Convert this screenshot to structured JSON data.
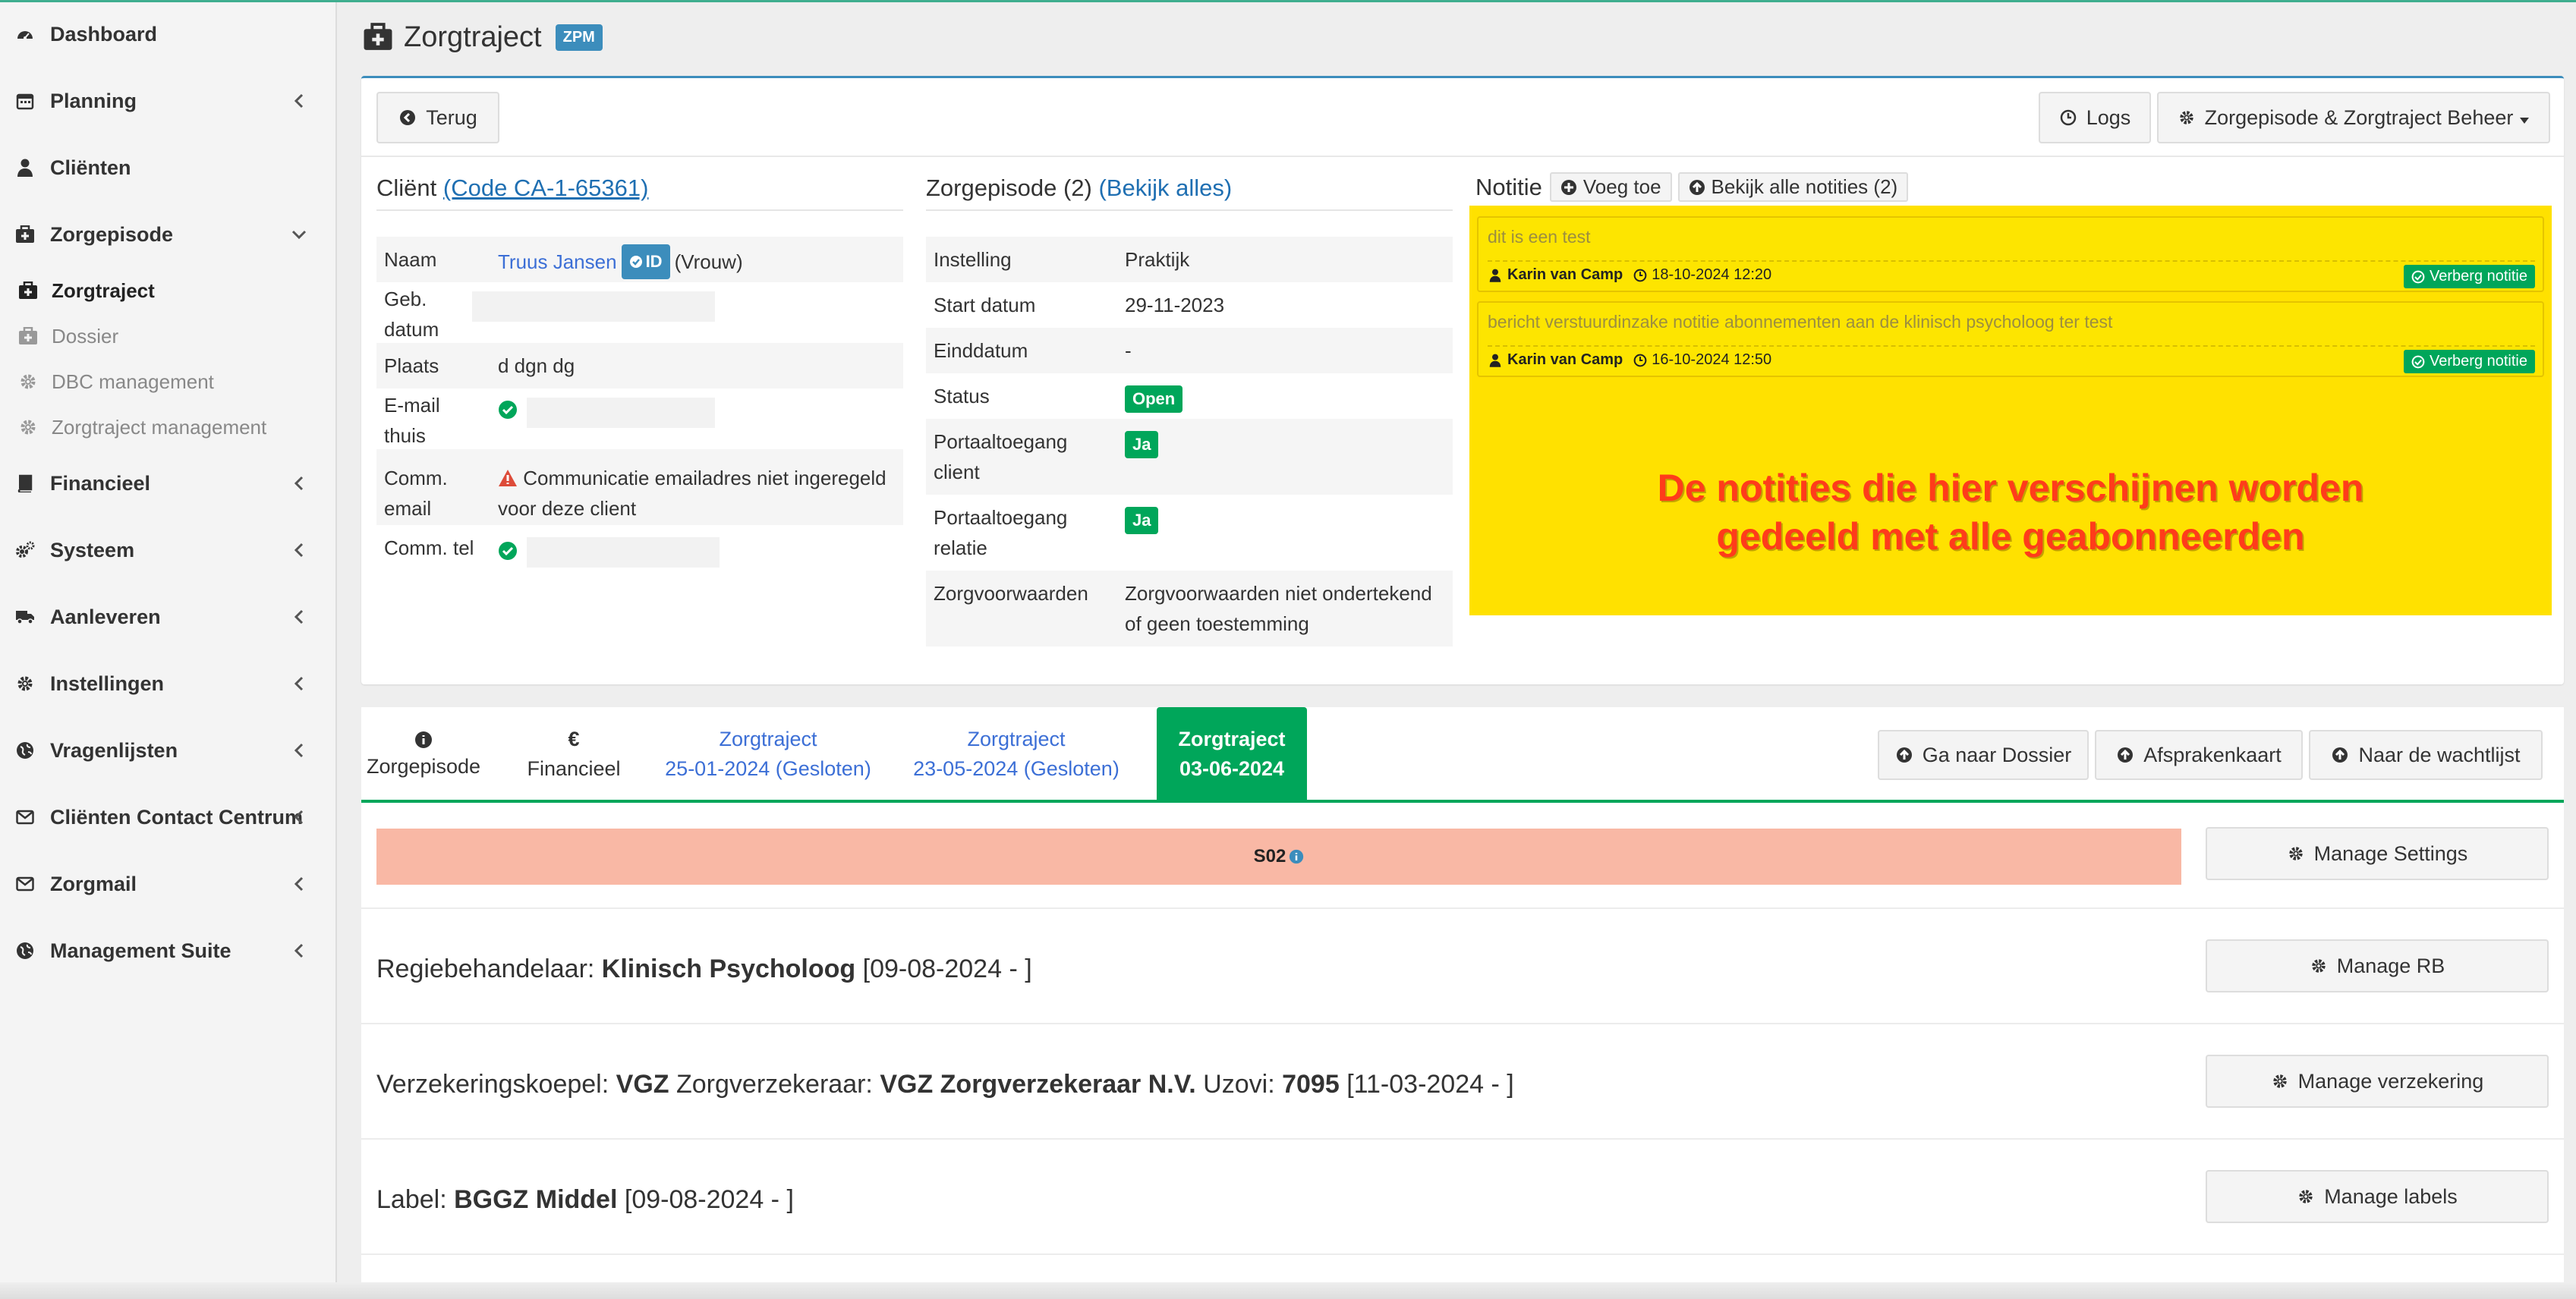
{
  "sidebar": {
    "items": [
      {
        "label": "Dashboard",
        "icon": "dashboard-icon"
      },
      {
        "label": "Planning",
        "icon": "calendar-icon"
      },
      {
        "label": "Cliënten",
        "icon": "user-icon"
      },
      {
        "label": "Zorgepisode",
        "icon": "medkit-icon"
      },
      {
        "label": "Financieel",
        "icon": "book-icon"
      },
      {
        "label": "Systeem",
        "icon": "cogs-icon"
      },
      {
        "label": "Aanleveren",
        "icon": "truck-icon"
      },
      {
        "label": "Instellingen",
        "icon": "gear-icon"
      },
      {
        "label": "Vragenlijsten",
        "icon": "globe-icon"
      },
      {
        "label": "Cliënten Contact Centrum",
        "icon": "envelope-icon"
      },
      {
        "label": "Zorgmail",
        "icon": "envelope-icon"
      },
      {
        "label": "Management Suite",
        "icon": "globe-icon"
      }
    ],
    "sub_items": [
      {
        "label": "Zorgtraject",
        "icon": "medkit-icon"
      },
      {
        "label": "Dossier",
        "icon": "medkit-icon"
      },
      {
        "label": "DBC management",
        "icon": "gear-icon"
      },
      {
        "label": "Zorgtraject management",
        "icon": "gear-icon"
      }
    ]
  },
  "header": {
    "title": "Zorgtraject",
    "badge": "ZPM"
  },
  "toolbar": {
    "back": "Terug",
    "logs": "Logs",
    "beheer": "Zorgepisode & Zorgtraject Beheer"
  },
  "client": {
    "heading": "Cliënt",
    "code_link": "(Code CA-1-65361)",
    "rows": [
      {
        "key": "Naam",
        "name": "Truus Jansen",
        "id_badge": "ID",
        "gender": "(Vrouw)"
      },
      {
        "key_line1": "Geb.",
        "key_line2": "datum"
      },
      {
        "key": "Plaats",
        "value": "d dgn dg"
      },
      {
        "key_line1": "E-mail",
        "key_line2": "thuis"
      },
      {
        "key_line1": "Comm.",
        "key_line2": "email",
        "value_line1": "Communicatie emailadres niet ingeregeld",
        "value_line2": "voor deze client"
      },
      {
        "key": "Comm. tel"
      }
    ]
  },
  "episode": {
    "heading": "Zorgepisode (2)",
    "link": "(Bekijk alles)",
    "rows": [
      {
        "key": "Instelling",
        "value": "Praktijk"
      },
      {
        "key": "Start datum",
        "value": "29-11-2023"
      },
      {
        "key": "Einddatum",
        "value": "-"
      },
      {
        "key": "Status",
        "value": "Open"
      },
      {
        "key_line1": "Portaaltoegang",
        "key_line2": "client",
        "value": "Ja"
      },
      {
        "key_line1": "Portaaltoegang",
        "key_line2": "relatie",
        "value": "Ja"
      },
      {
        "key": "Zorgvoorwaarden",
        "value_line1": "Zorgvoorwaarden niet ondertekend",
        "value_line2": "of geen toestemming"
      }
    ]
  },
  "notes": {
    "heading": "Notitie",
    "add": "Voeg toe",
    "view_all": "Bekijk alle notities (2)",
    "items": [
      {
        "text": "dit is een test",
        "author": "Karin van Camp",
        "time": "18-10-2024 12:20",
        "hide": "Verberg notitie"
      },
      {
        "text": "bericht verstuurdinzake notitie abonnementen aan de klinisch psycholoog ter test",
        "author": "Karin van Camp",
        "time": "16-10-2024 12:50",
        "hide": "Verberg notitie"
      }
    ],
    "overlay_line1": "De notities die hier verschijnen worden",
    "overlay_line2": "gedeeld met alle geabonneerden"
  },
  "tabs": [
    {
      "icon": "info-icon",
      "label": "Zorgepisode"
    },
    {
      "symbol": "€",
      "label": "Financieel"
    },
    {
      "line1": "Zorgtraject",
      "line2": "25-01-2024 (Gesloten)"
    },
    {
      "line1": "Zorgtraject",
      "line2": "23-05-2024 (Gesloten)"
    },
    {
      "line1": "Zorgtraject",
      "line2": "03-06-2024"
    }
  ],
  "actions": {
    "dossier": "Ga naar Dossier",
    "afspraken": "Afsprakenkaart",
    "wachtlijst": "Naar de wachtlijst"
  },
  "s02": {
    "label": "S02"
  },
  "manage": {
    "settings": "Manage Settings",
    "rb": "Manage RB",
    "verzekering": "Manage verzekering",
    "labels": "Manage labels"
  },
  "rows": {
    "rb_label": "Regiebehandelaar:",
    "rb_value": "Klinisch Psycholoog",
    "rb_date": "[09-08-2024 - ]",
    "vk_label": "Verzekeringskoepel:",
    "vk_value": "VGZ",
    "zv_label": "Zorgverzekeraar:",
    "zv_value": "VGZ Zorgverzekeraar N.V.",
    "uz_label": "Uzovi:",
    "uz_value": "7095",
    "vk_date": "[11-03-2024 - ]",
    "label_label": "Label:",
    "label_value": "BGGZ Middel",
    "label_date": "[09-08-2024 - ]"
  },
  "colors": {
    "primary": "#3c8dbc",
    "success": "#00a65a",
    "note_bg": "#ffe100",
    "s02": "#f9b8a5",
    "overlay": "#ff3c1a"
  }
}
